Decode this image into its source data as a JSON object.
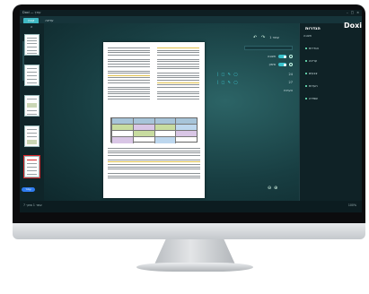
{
  "window": {
    "title": "Doxi — עורך",
    "tabs": [
      "קובץ",
      "עריכה"
    ]
  },
  "sidebar": {
    "header": "הגדרות",
    "subtitle": "תצוגה",
    "items": [
      "הגדרות",
      "עריכה",
      "צבעים",
      "הערות",
      "שמירה"
    ]
  },
  "logo": {
    "text": "Doxi"
  },
  "toolbar": {
    "label": "עמוד 1"
  },
  "controls": {
    "row1": "תצוגה",
    "row2": "סימון",
    "row3": "24",
    "row4": "27",
    "row5": "הערות"
  },
  "thumbnails": {
    "count": 7,
    "selected_index": 5,
    "badge": "עמוד"
  },
  "statusbar": {
    "left": "עמוד 1 מתוך 7",
    "right": "100%"
  },
  "colors": {
    "accent": "#3fb9c4",
    "selection": "#d8262b",
    "highlight": "#e0c14a",
    "badge": "#2f7cf0"
  },
  "icons": [
    "minimize-icon",
    "maximize-icon",
    "close-icon",
    "undo-icon",
    "redo-icon",
    "zoom-in-icon",
    "zoom-out-icon",
    "chevron-up-icon"
  ]
}
